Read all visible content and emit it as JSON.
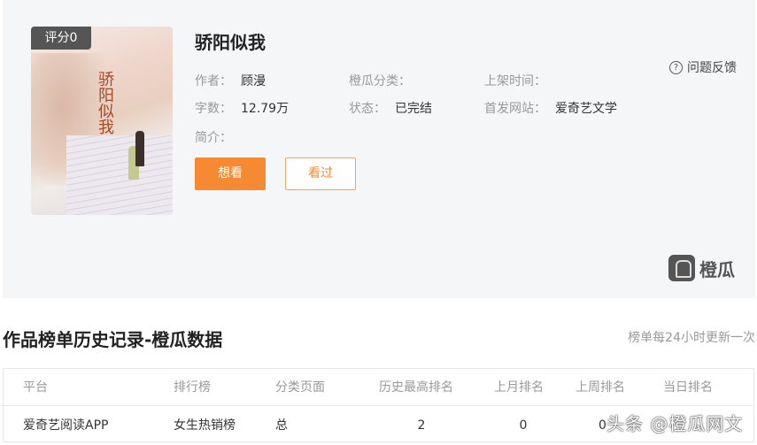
{
  "book": {
    "score": "评分0",
    "cover_title": "骄阳似我",
    "title": "骄阳似我",
    "author_label": "作者：",
    "author": "顾漫",
    "category_label": "橙瓜分类：",
    "category": "",
    "listed_label": "上架时间：",
    "listed": "",
    "words_label": "字数：",
    "words": "12.79万",
    "status_label": "状态：",
    "status": "已完结",
    "site_label": "首发网站：",
    "site": "爱奇艺文学",
    "intro_label": "简介：",
    "want_button": "想看",
    "seen_button": "看过",
    "feedback": "问题反馈",
    "logo_text": "橙瓜"
  },
  "history": {
    "title": "作品榜单历史记录-橙瓜数据",
    "note": "榜单每24小时更新一次",
    "columns": [
      "平台",
      "排行榜",
      "分类页面",
      "历史最高排名",
      "上月排名",
      "上周排名",
      "当日排名"
    ],
    "rows": [
      [
        "爱奇艺阅读APP",
        "女生热销榜",
        "总",
        "2",
        "0",
        "0",
        ""
      ]
    ]
  },
  "watermark": "头条 @橙瓜网文",
  "colors": {
    "accent": "#f68a33",
    "panel": "#f5f6f8"
  }
}
